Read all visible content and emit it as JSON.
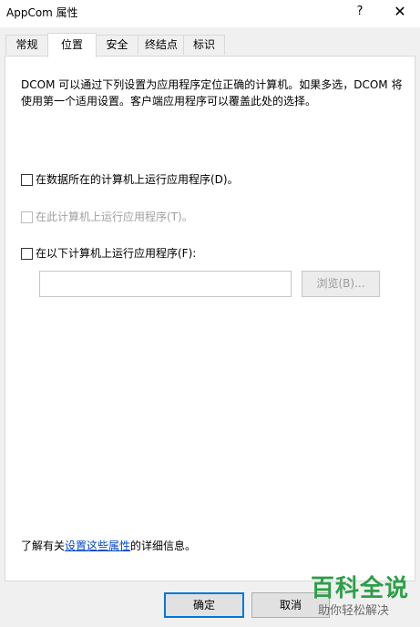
{
  "window": {
    "title": "AppCom 属性",
    "help": "?",
    "close": "✕"
  },
  "tabs": [
    "常规",
    "位置",
    "安全",
    "终结点",
    "标识"
  ],
  "active_tab": "位置",
  "location": {
    "description": "DCOM 可以通过下列设置为应用程序定位正确的计算机。如果多选，DCOM 将使用第一个适用设置。客户端应用程序可以覆盖此处的选择。",
    "option1": {
      "label": "在数据所在的计算机上运行应用程序(D)。",
      "checked": false,
      "enabled": true
    },
    "option2": {
      "label": "在此计算机上运行应用程序(T)。",
      "checked": false,
      "enabled": false
    },
    "option3": {
      "label": "在以下计算机上运行应用程序(F):",
      "checked": false,
      "enabled": true
    },
    "computer_value": "",
    "browse_label": "浏览(B)..."
  },
  "footer": {
    "prefix": "了解有关",
    "link": "设置这些属性",
    "suffix": "的详细信息。"
  },
  "buttons": {
    "ok": "确定",
    "cancel": "取消"
  },
  "watermark": {
    "big": "百科全说",
    "small": "助你轻松解决"
  }
}
